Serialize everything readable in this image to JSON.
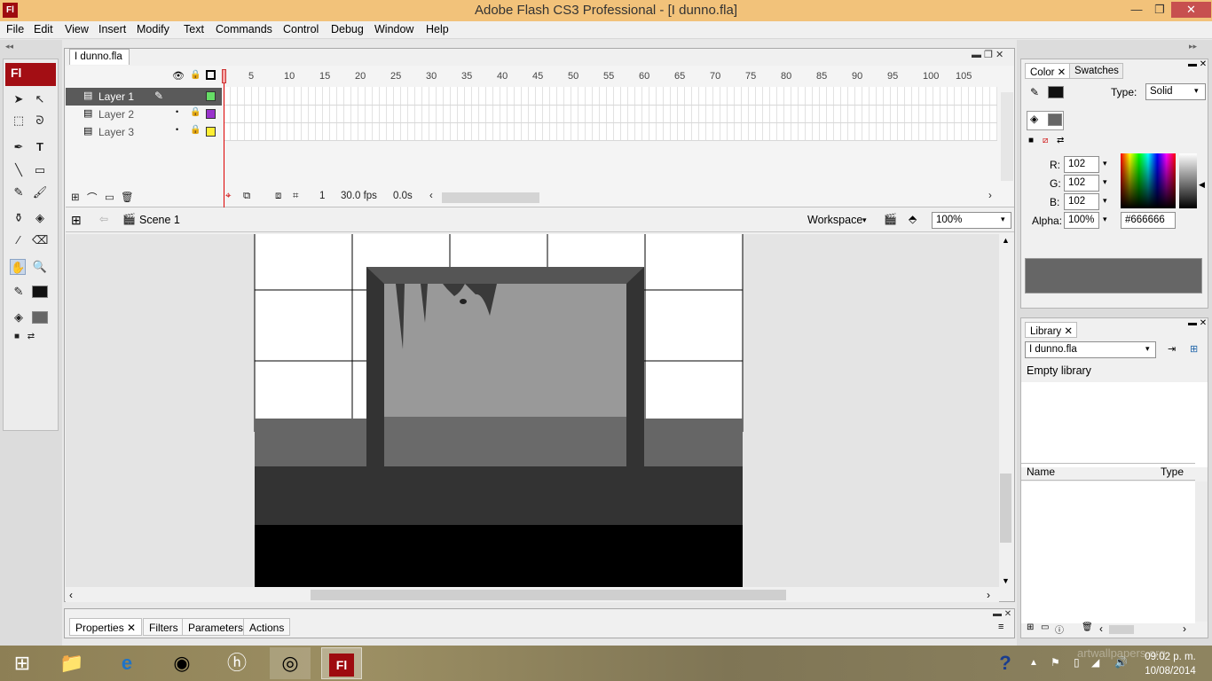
{
  "window": {
    "title": "Adobe Flash CS3 Professional - [I dunno.fla]",
    "logo": "Fl",
    "minimize_glyph": "—",
    "maximize_glyph": "❐",
    "close_glyph": "✕"
  },
  "menu": [
    "File",
    "Edit",
    "View",
    "Insert",
    "Modify",
    "Text",
    "Commands",
    "Control",
    "Debug",
    "Window",
    "Help"
  ],
  "tools": {
    "logo": "Fl"
  },
  "document": {
    "tab": "I dunno.fla"
  },
  "timeline": {
    "layers": [
      {
        "name": "Layer 1",
        "color": "#66dd66"
      },
      {
        "name": "Layer 2",
        "color": "#9933cc"
      },
      {
        "name": "Layer 3",
        "color": "#ffee33"
      }
    ],
    "ruler": [
      "5",
      "10",
      "15",
      "20",
      "25",
      "30",
      "35",
      "40",
      "45",
      "50",
      "55",
      "60",
      "65",
      "70",
      "75",
      "80",
      "85",
      "90",
      "95",
      "100",
      "105"
    ],
    "current_frame": "1",
    "fps": "30.0 fps",
    "time": "0.0s"
  },
  "editbar": {
    "scene": "Scene 1",
    "workspace": "Workspace",
    "zoom": "100%"
  },
  "properties": {
    "tabs": [
      "Properties",
      "Filters",
      "Parameters",
      "Actions"
    ]
  },
  "color_panel": {
    "tabs": [
      "Color",
      "Swatches"
    ],
    "type_label": "Type:",
    "type_value": "Solid",
    "r_label": "R:",
    "r": "102",
    "g_label": "G:",
    "g": "102",
    "b_label": "B:",
    "b": "102",
    "alpha_label": "Alpha:",
    "alpha": "100%",
    "hex": "#666666",
    "swatch_color": "#666666"
  },
  "library": {
    "tab": "Library",
    "file": "I dunno.fla",
    "empty": "Empty library",
    "col_name": "Name",
    "col_type": "Type"
  },
  "taskbar": {
    "time": "09:02 p. m.",
    "date": "10/08/2014",
    "watermark": "artwallpapers.org"
  }
}
